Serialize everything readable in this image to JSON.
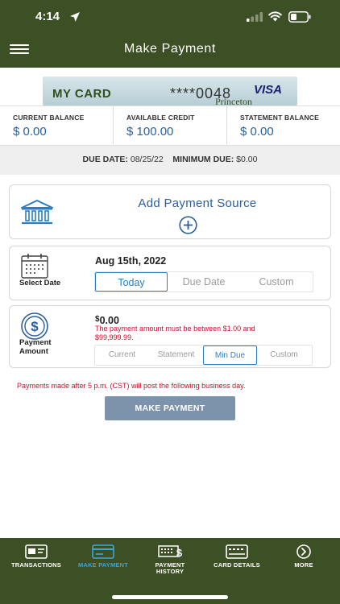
{
  "status_bar": {
    "time": "4:14"
  },
  "header": {
    "title": "Make Payment"
  },
  "card": {
    "name": "MY CARD",
    "masked_number": "****0048",
    "network": "VISA",
    "bank": "Princeton"
  },
  "balances": [
    {
      "label": "CURRENT BALANCE",
      "value": "$ 0.00"
    },
    {
      "label": "AVAILABLE CREDIT",
      "value": "$ 100.00"
    },
    {
      "label": "STATEMENT BALANCE",
      "value": "$ 0.00"
    }
  ],
  "due": {
    "date_label": "DUE DATE:",
    "date_value": "08/25/22",
    "min_label": "MINIMUM DUE:",
    "min_value": "$0.00"
  },
  "payment_source": {
    "label": "Add Payment Source"
  },
  "date_select": {
    "label": "Select Date",
    "value": "Aug 15th, 2022",
    "options": [
      "Today",
      "Due Date",
      "Custom"
    ],
    "selected": "Today"
  },
  "amount": {
    "label_line1": "Payment",
    "label_line2": "Amount",
    "currency": "$",
    "value": "0.00",
    "error": "The payment amount must be between $1.00 and $99,999.99.",
    "options": [
      "Current",
      "Statement",
      "Min Due",
      "Custom"
    ],
    "selected": "Min Due"
  },
  "notice": "Payments made after 5 p.m. (CST) will post the following business day.",
  "submit_label": "MAKE PAYMENT",
  "bottom_nav": [
    {
      "label_line1": "TRANSACTIONS",
      "label_line2": "",
      "icon": "transactions-icon"
    },
    {
      "label_line1": "MAKE PAYMENT",
      "label_line2": "",
      "icon": "make-payment-icon"
    },
    {
      "label_line1": "PAYMENT",
      "label_line2": "HISTORY",
      "icon": "payment-history-icon"
    },
    {
      "label_line1": "CARD DETAILS",
      "label_line2": "",
      "icon": "card-details-icon"
    },
    {
      "label_line1": "MORE",
      "label_line2": "",
      "icon": "more-icon"
    }
  ],
  "colors": {
    "header_bg": "#3d4f25",
    "accent_blue": "#2a5f9e",
    "active_nav": "#3aa5dd",
    "error_red": "#c8102e",
    "button_bg": "#7d93ab"
  }
}
